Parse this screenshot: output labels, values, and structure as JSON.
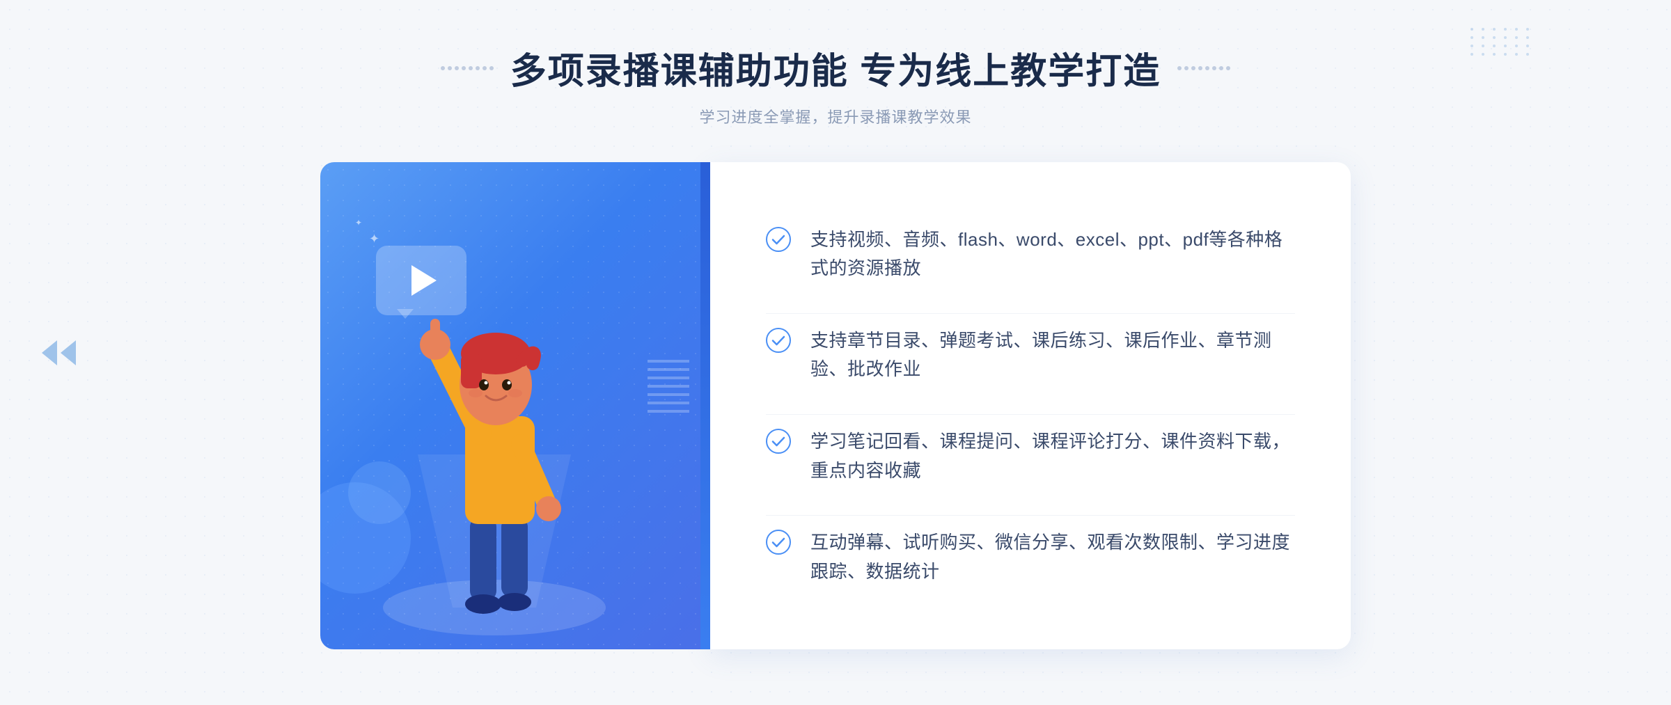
{
  "header": {
    "title": "多项录播课辅助功能 专为线上教学打造",
    "subtitle": "学习进度全掌握，提升录播课教学效果",
    "title_dots_left": "decorative",
    "title_dots_right": "decorative"
  },
  "features": [
    {
      "id": 1,
      "text": "支持视频、音频、flash、word、excel、ppt、pdf等各种格式的资源播放"
    },
    {
      "id": 2,
      "text": "支持章节目录、弹题考试、课后练习、课后作业、章节测验、批改作业"
    },
    {
      "id": 3,
      "text": "学习笔记回看、课程提问、课程评论打分、课件资料下载，重点内容收藏"
    },
    {
      "id": 4,
      "text": "互动弹幕、试听购买、微信分享、观看次数限制、学习进度跟踪、数据统计"
    }
  ],
  "colors": {
    "primary_blue": "#3a7ef0",
    "light_blue": "#5b9ef5",
    "dark_text": "#1a2b4a",
    "medium_text": "#3a4a6a",
    "light_text": "#8a9ab5",
    "check_color": "#4a8ff5",
    "white": "#ffffff"
  },
  "icons": {
    "check_circle": "check-circle-icon",
    "play": "play-icon",
    "left_arrows": "navigation-left-icon"
  }
}
